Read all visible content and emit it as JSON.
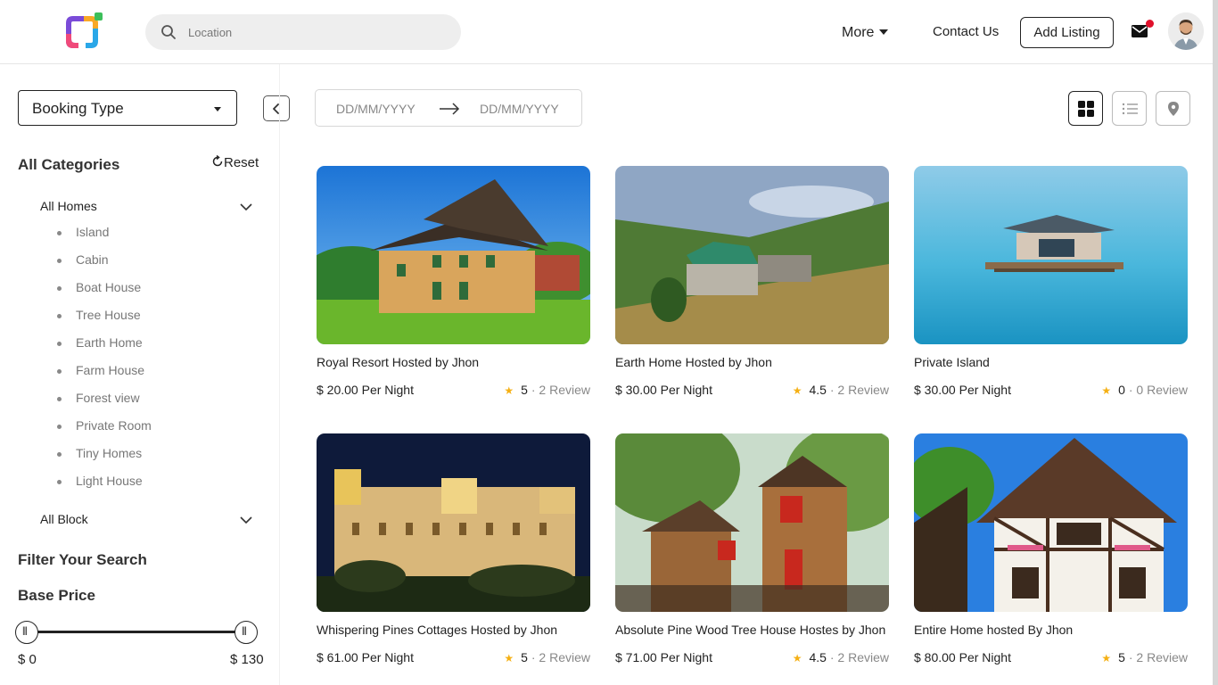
{
  "header": {
    "search_placeholder": "Location",
    "nav_more": "More",
    "nav_contact": "Contact Us",
    "add_listing": "Add Listing"
  },
  "sidebar": {
    "booking_type": "Booking Type",
    "categories_title": "All Categories",
    "reset": "Reset",
    "all_homes": "All Homes",
    "home_types": [
      "Island",
      "Cabin",
      "Boat House",
      "Tree House",
      "Earth Home",
      "Farm House",
      "Forest view",
      "Private Room",
      "Tiny Homes",
      "Light House"
    ],
    "all_block": "All Block",
    "filter_title": "Filter Your Search",
    "base_price_title": "Base Price",
    "price_min": "$ 0",
    "price_max": "$ 130",
    "price_range_fraction": [
      0,
      1
    ]
  },
  "dates": {
    "start_placeholder": "DD/MM/YYYY",
    "end_placeholder": "DD/MM/YYYY"
  },
  "listings": [
    {
      "title": "Royal Resort  Hosted by Jhon",
      "price": "$ 20.00 Per Night",
      "rating": "5",
      "reviews": "· 2 Review"
    },
    {
      "title": "Earth Home Hosted by Jhon",
      "price": "$ 30.00 Per Night",
      "rating": "4.5",
      "reviews": "· 2 Review"
    },
    {
      "title": "Private Island",
      "price": "$ 30.00 Per Night",
      "rating": "0",
      "reviews": "· 0 Review"
    },
    {
      "title": "Whispering Pines Cottages Hosted by Jhon",
      "price": "$ 61.00 Per Night",
      "rating": "5",
      "reviews": "· 2 Review"
    },
    {
      "title": "Absolute Pine Wood Tree House Hostes by Jhon",
      "price": "$ 71.00 Per Night",
      "rating": "4.5",
      "reviews": "· 2 Review"
    },
    {
      "title": "Entire Home hosted By Jhon",
      "price": "$ 80.00 Per Night",
      "rating": "5",
      "reviews": "· 2 Review"
    }
  ],
  "colors": {
    "accent_star": "#f5b014",
    "notification_dot": "#e0102b"
  },
  "icons": [
    "logo-icon",
    "search-icon",
    "mail-icon",
    "refresh-icon",
    "chevron-down-icon",
    "chevron-left-icon",
    "arrow-right-icon",
    "grid-view-icon",
    "list-view-icon",
    "map-pin-icon",
    "star-icon"
  ]
}
